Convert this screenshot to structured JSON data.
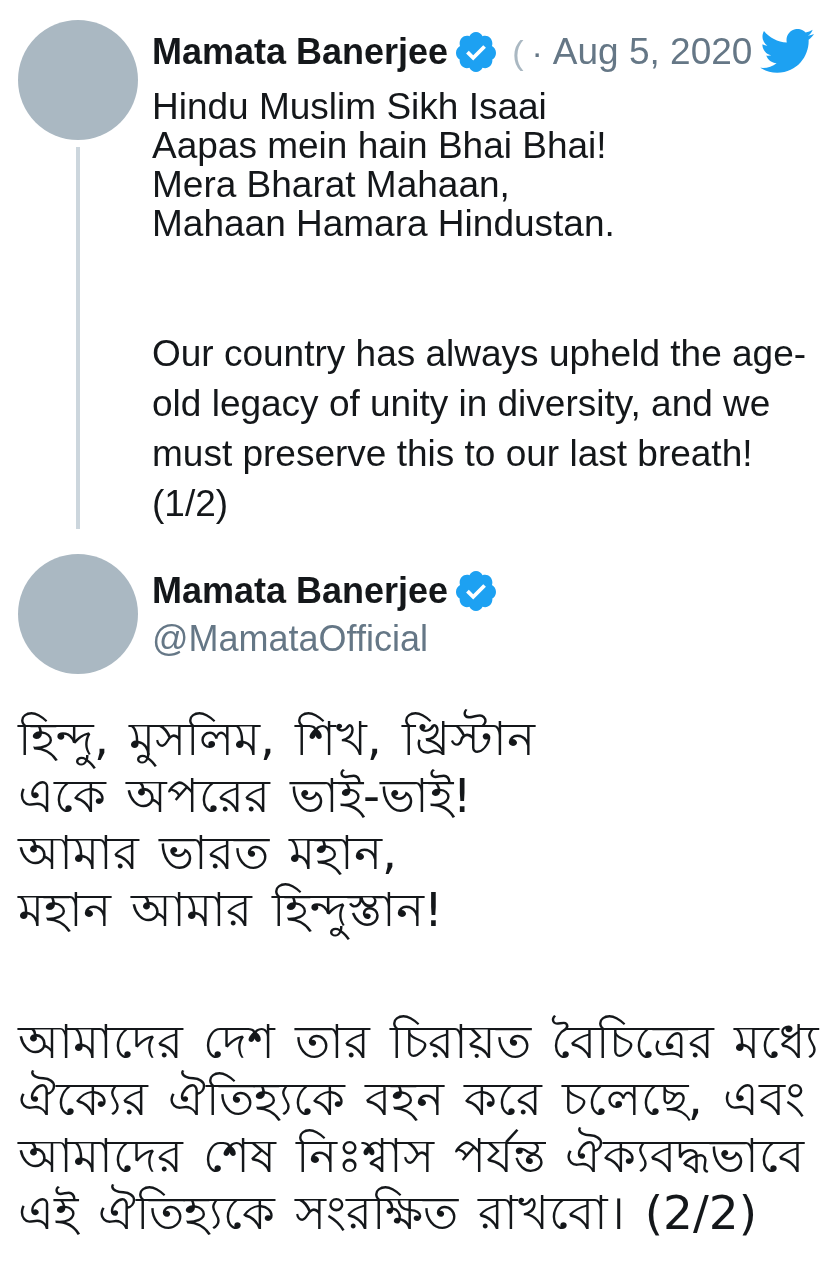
{
  "tweets": [
    {
      "kind": "thread",
      "author": {
        "name": "Mamata Banerjee",
        "verified": true,
        "handle": "("
      },
      "separator": "·",
      "date": "Aug 5, 2020",
      "paragraphs": [
        [
          "Hindu Muslim Sikh Isaai",
          "Aapas mein hain Bhai Bhai!",
          "Mera Bharat Mahaan,",
          "Mahaan Hamara Hindustan."
        ],
        [
          "Our country has always upheld the age-",
          "old legacy of unity in diversity, and we",
          "must preserve this to our last breath!",
          "(1/2)"
        ]
      ]
    },
    {
      "kind": "expanded",
      "author": {
        "name": "Mamata Banerjee",
        "verified": true,
        "handle": "@MamataOfficial"
      },
      "paragraphs": [
        [
          "হিন্দু, মুসলিম, শিখ, খ্রিস্টান",
          "একে অপরের ভাই-ভাই!",
          "আমার ভারত মহান,",
          "মহান আমার হিন্দুস্তান!"
        ],
        [
          "আমাদের দেশ তার চিরায়ত বৈচিত্রের মধ্যে",
          "ঐক্যের ঐতিহ্যকে বহন করে চলেছে, এবং",
          "আমাদের শেষ নিঃশ্বাস পর্যন্ত ঐক্যবদ্ধভাবে",
          "এই ঐতিহ্যকে সংরক্ষিত রাখবো। (2/2)"
        ]
      ]
    }
  ]
}
